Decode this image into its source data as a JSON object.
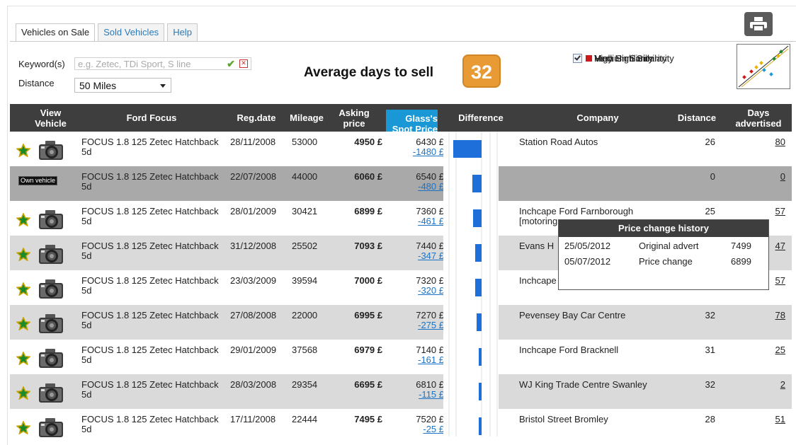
{
  "tabs": [
    "Vehicles on Sale",
    "Sold Vehicles",
    "Help"
  ],
  "filters": {
    "keyword_label": "Keyword(s)",
    "keyword_placeholder": "e.g. Zetec, TDi Sport, S line",
    "distance_label": "Distance",
    "distance_value": "50 Miles"
  },
  "summary": {
    "label": "Average days to sell",
    "value": "32"
  },
  "legend": [
    {
      "label": "Very High Similarity",
      "color": "#1a8a2a"
    },
    {
      "label": "High Similarity",
      "color": "#e8b400"
    },
    {
      "label": "Medium Similarity",
      "color": "#cc1a1a"
    }
  ],
  "columns": {
    "view": "View Vehicle",
    "model": "Ford Focus",
    "reg": "Reg.date",
    "mileage": "Mileage",
    "asking": "Asking price",
    "spot": "Glass's Spot Price",
    "difference": "Difference",
    "company": "Company",
    "distance": "Distance",
    "days": "Days advertised"
  },
  "own_vehicle_label": "Own vehicle",
  "rows": [
    {
      "model": "FOCUS 1.8 125 Zetec Hatchback 5d",
      "reg": "28/11/2008",
      "mileage": "53000",
      "asking": "4950 £",
      "spot": "6430 £",
      "diff": "-1480 £",
      "company": "Station Road Autos",
      "distance": "26",
      "days": "80",
      "own": false
    },
    {
      "model": "FOCUS 1.8 125 Zetec Hatchback 5d",
      "reg": "22/07/2008",
      "mileage": "44000",
      "asking": "6060 £",
      "spot": "6540 £",
      "diff": "-480 £",
      "company": "",
      "distance": "0",
      "days": "0",
      "own": true
    },
    {
      "model": "FOCUS 1.8 125 Zetec Hatchback 5d",
      "reg": "28/01/2009",
      "mileage": "30421",
      "asking": "6899 £",
      "spot": "7360 £",
      "diff": "-461 £",
      "company": "Inchcape Ford Farnborough [motoring",
      "distance": "25",
      "days": "57",
      "own": false
    },
    {
      "model": "FOCUS 1.8 125 Zetec Hatchback 5d",
      "reg": "31/12/2008",
      "mileage": "25502",
      "asking": "7093 £",
      "spot": "7440 £",
      "diff": "-347 £",
      "company": "Evans H",
      "distance": "",
      "days": "47",
      "own": false
    },
    {
      "model": "FOCUS 1.8 125 Zetec Hatchback 5d",
      "reg": "23/03/2009",
      "mileage": "39594",
      "asking": "7000 £",
      "spot": "7320 £",
      "diff": "-320 £",
      "company": "Inchcape",
      "distance": "",
      "days": "57",
      "own": false
    },
    {
      "model": "FOCUS 1.8 125 Zetec Hatchback 5d",
      "reg": "27/08/2008",
      "mileage": "22000",
      "asking": "6995 £",
      "spot": "7270 £",
      "diff": "-275 £",
      "company": "Pevensey Bay Car Centre",
      "distance": "32",
      "days": "78",
      "own": false
    },
    {
      "model": "FOCUS 1.8 125 Zetec Hatchback 5d",
      "reg": "29/01/2009",
      "mileage": "37568",
      "asking": "6979 £",
      "spot": "7140 £",
      "diff": "-161 £",
      "company": "Inchcape Ford Bracknell",
      "distance": "31",
      "days": "25",
      "own": false
    },
    {
      "model": "FOCUS 1.8 125 Zetec Hatchback 5d",
      "reg": "28/03/2008",
      "mileage": "29354",
      "asking": "6695 £",
      "spot": "6810 £",
      "diff": "-115 £",
      "company": "WJ King Trade Centre Swanley",
      "distance": "32",
      "days": "2",
      "own": false
    },
    {
      "model": "FOCUS 1.8 125 Zetec Hatchback 5d",
      "reg": "17/11/2008",
      "mileage": "22444",
      "asking": "7495 £",
      "spot": "7520 £",
      "diff": "-25 £",
      "company": "Bristol Street Bromley",
      "distance": "28",
      "days": "51",
      "own": false
    }
  ],
  "tooltip": {
    "title": "Price change history",
    "entries": [
      {
        "date": "25/05/2012",
        "event": "Original advert",
        "price": "7499"
      },
      {
        "date": "05/07/2012",
        "event": "Price change",
        "price": "6899"
      }
    ]
  }
}
